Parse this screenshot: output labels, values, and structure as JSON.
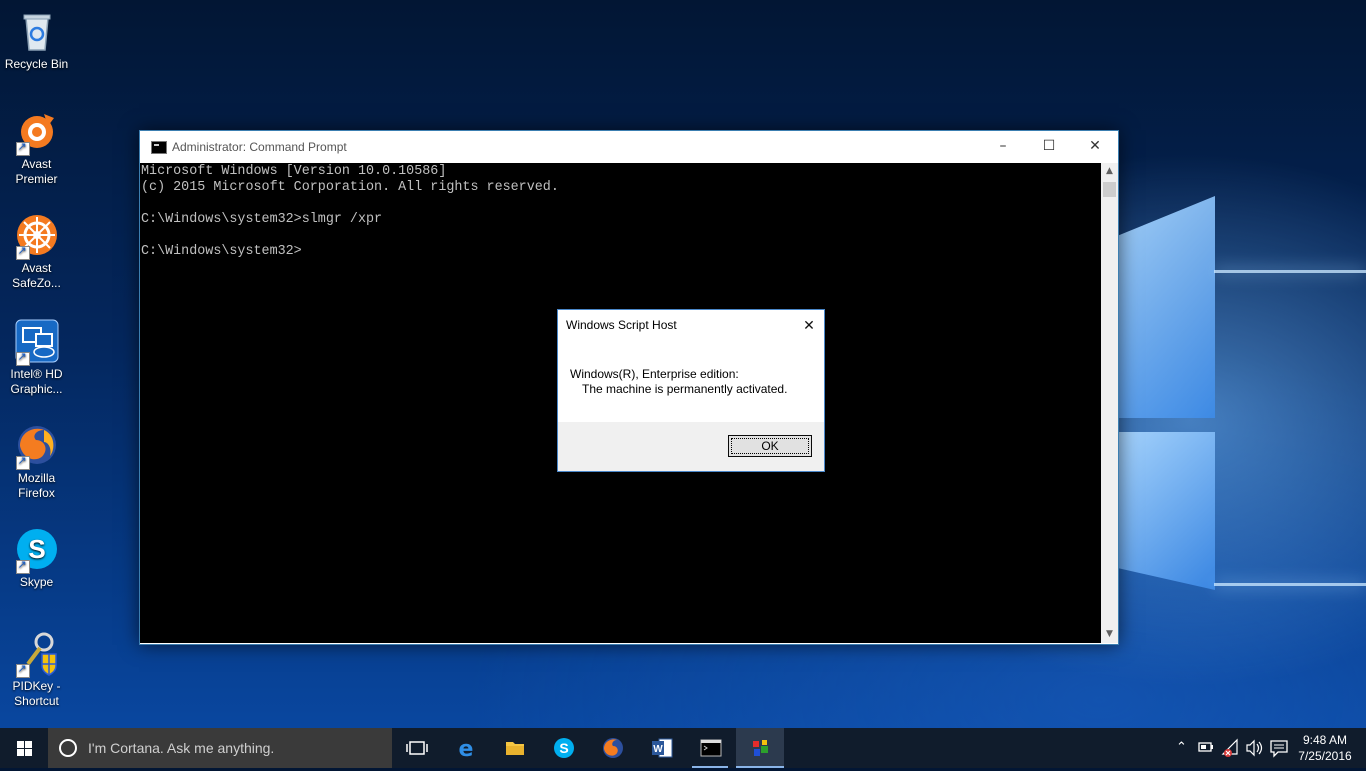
{
  "desktop": {
    "icons": [
      {
        "label_line1": "Recycle Bin",
        "label_line2": "",
        "icon": "recycle-bin-icon"
      },
      {
        "label_line1": "Avast",
        "label_line2": "Premier",
        "icon": "avast-icon"
      },
      {
        "label_line1": "Avast",
        "label_line2": "SafeZo...",
        "icon": "avast-safezone-icon"
      },
      {
        "label_line1": "Intel® HD",
        "label_line2": "Graphic...",
        "icon": "intel-graphics-icon"
      },
      {
        "label_line1": "Mozilla",
        "label_line2": "Firefox",
        "icon": "firefox-icon"
      },
      {
        "label_line1": "Skype",
        "label_line2": "",
        "icon": "skype-icon"
      },
      {
        "label_line1": "PIDKey -",
        "label_line2": "Shortcut",
        "icon": "pidkey-icon"
      }
    ]
  },
  "cmd": {
    "title": "Administrator: Command Prompt",
    "lines": [
      "Microsoft Windows [Version 10.0.10586]",
      "(c) 2015 Microsoft Corporation. All rights reserved.",
      "",
      "C:\\Windows\\system32>slmgr /xpr",
      "",
      "C:\\Windows\\system32>"
    ]
  },
  "dialog": {
    "title": "Windows Script Host",
    "message_line1": "Windows(R), Enterprise edition:",
    "message_line2": "The machine is permanently activated.",
    "ok_label": "OK"
  },
  "taskbar": {
    "search_placeholder": "I'm Cortana. Ask me anything.",
    "clock_time": "9:48 AM",
    "clock_date": "7/25/2016"
  }
}
